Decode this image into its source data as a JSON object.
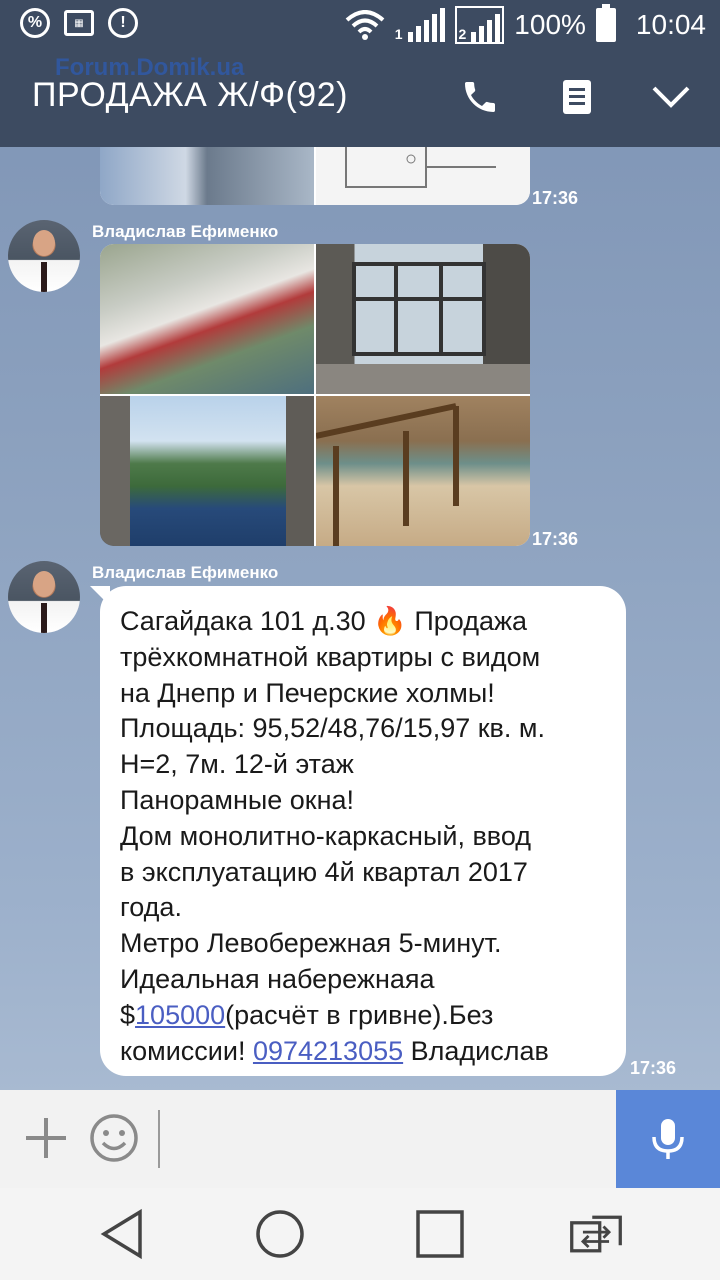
{
  "status_bar": {
    "battery": "100%",
    "time": "10:04",
    "sim1": "1",
    "sim2": "2",
    "icons": [
      "percent-icon",
      "calendar-icon",
      "alert-icon",
      "wifi-icon",
      "signal-icon",
      "battery-icon"
    ]
  },
  "header": {
    "title": "ПРОДАЖА Ж/Ф(92)",
    "watermark": "Forum.Domik.ua",
    "icons": [
      "phone-icon",
      "document-icon",
      "chevron-down-icon"
    ]
  },
  "messages": [
    {
      "time": "17:36"
    },
    {
      "sender": "Владислав Ефименко",
      "time": "17:36"
    },
    {
      "sender": "Владислав Ефименко",
      "time": "17:36",
      "lines": [
        {
          "text": "Сагайдака 101 д.30 ",
          "emoji": "🔥",
          "after": " Продажа"
        },
        {
          "text": "трёхкомнатной квартиры с видом"
        },
        {
          "text": "на Днепр и Печерские холмы!"
        },
        {
          "text": "Площадь: 95,52/48,76/15,97 кв. м."
        },
        {
          "text": "Н=2, 7м. 12-й этаж"
        },
        {
          "text": "Панорамные окна!"
        },
        {
          "text": "Дом монолитно-каркасный, ввод"
        },
        {
          "text": "в эксплуатацию 4й квартал 2017"
        },
        {
          "text": "года."
        },
        {
          "text": "Метро Левобережная 5-минут."
        },
        {
          "text": "Идеальная набережнаяа"
        }
      ],
      "price_prefix": "$",
      "price_link": "105000",
      "price_suffix": "(расчёт в гривне).Без",
      "last_prefix": "комиссии! ",
      "phone_link": "0974213055",
      "last_suffix": " Владислав"
    }
  ]
}
